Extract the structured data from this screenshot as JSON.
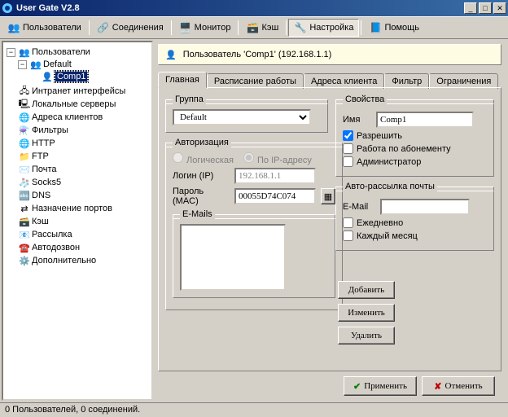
{
  "window": {
    "title": "User Gate V2.8"
  },
  "toolbar": {
    "users": "Пользователи",
    "connections": "Соединения",
    "monitor": "Монитор",
    "cache": "Кэш",
    "settings": "Настройка",
    "help": "Помощь"
  },
  "tree": {
    "root": "Пользователи",
    "default_group": "Default",
    "user": "Comp1",
    "intranet": "Интранет интерфейсы",
    "local_servers": "Локальные серверы",
    "client_addr": "Адреса клиентов",
    "filters": "Фильтры",
    "http": "HTTP",
    "ftp": "FTP",
    "mail": "Почта",
    "socks5": "Socks5",
    "dns": "DNS",
    "ports": "Назначение портов",
    "cache": "Кэш",
    "mailing": "Рассылка",
    "autodial": "Автодозвон",
    "advanced": "Дополнительно"
  },
  "header": {
    "text": "Пользователь 'Comp1' (192.168.1.1)"
  },
  "tabs": {
    "main": "Главная",
    "schedule": "Расписание работы",
    "client_addr": "Адреса клиента",
    "filter": "Фильтр",
    "limits": "Ограничения"
  },
  "group": {
    "legend": "Группа",
    "selected": "Default"
  },
  "auth": {
    "legend": "Авторизация",
    "logical": "Логическая",
    "by_ip": "По IP-адресу",
    "login_label": "Логин (IP)",
    "login_value": "192.168.1.1",
    "pass_label": "Пароль (MAC)",
    "pass_value": "00055D74C074"
  },
  "emails": {
    "legend": "E-Mails",
    "content": "",
    "add": "Добавить",
    "edit": "Изменить",
    "delete": "Удалить"
  },
  "props": {
    "legend": "Свойства",
    "name_label": "Имя",
    "name_value": "Comp1",
    "allow": "Разрешить",
    "subscription": "Работа по абонементу",
    "admin": "Администратор"
  },
  "automail": {
    "legend": "Авто-рассылка почты",
    "email_label": "E-Mail",
    "email_value": "",
    "daily": "Ежедневно",
    "monthly": "Каждый месяц"
  },
  "buttons": {
    "apply": "Применить",
    "cancel": "Отменить"
  },
  "status": "0 Пользователей, 0 соединений."
}
